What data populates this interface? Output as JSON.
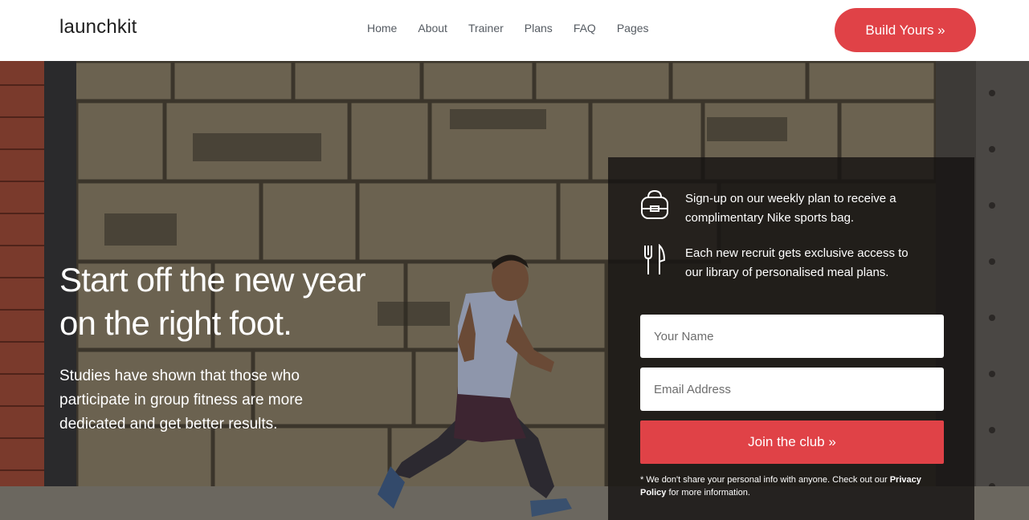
{
  "brand": "launchkit",
  "nav": {
    "links": [
      "Home",
      "About",
      "Trainer",
      "Plans",
      "FAQ",
      "Pages"
    ],
    "cta_label": "Build Yours »"
  },
  "hero": {
    "title_line1": "Start off the new year",
    "title_line2": "on the right foot.",
    "subtitle": "Studies have shown that those who participate in group fitness are more dedicated and get better results."
  },
  "signup": {
    "perks": [
      {
        "icon": "bag-icon",
        "text": "Sign-up on our weekly plan to receive a complimentary Nike sports bag."
      },
      {
        "icon": "fork-knife-icon",
        "text": "Each new recruit gets exclusive access to our library of personalised meal plans."
      }
    ],
    "name_placeholder": "Your Name",
    "name_value": "",
    "email_placeholder": "Email Address",
    "email_value": "",
    "submit_label": "Join the club »",
    "disclaimer_prefix": "* We don't share your personal info with anyone. Check out our",
    "privacy_link": "Privacy Policy",
    "disclaimer_suffix": "for more information."
  },
  "colors": {
    "accent": "#e04247",
    "panel": "#161412",
    "nav_text": "#555b62"
  }
}
